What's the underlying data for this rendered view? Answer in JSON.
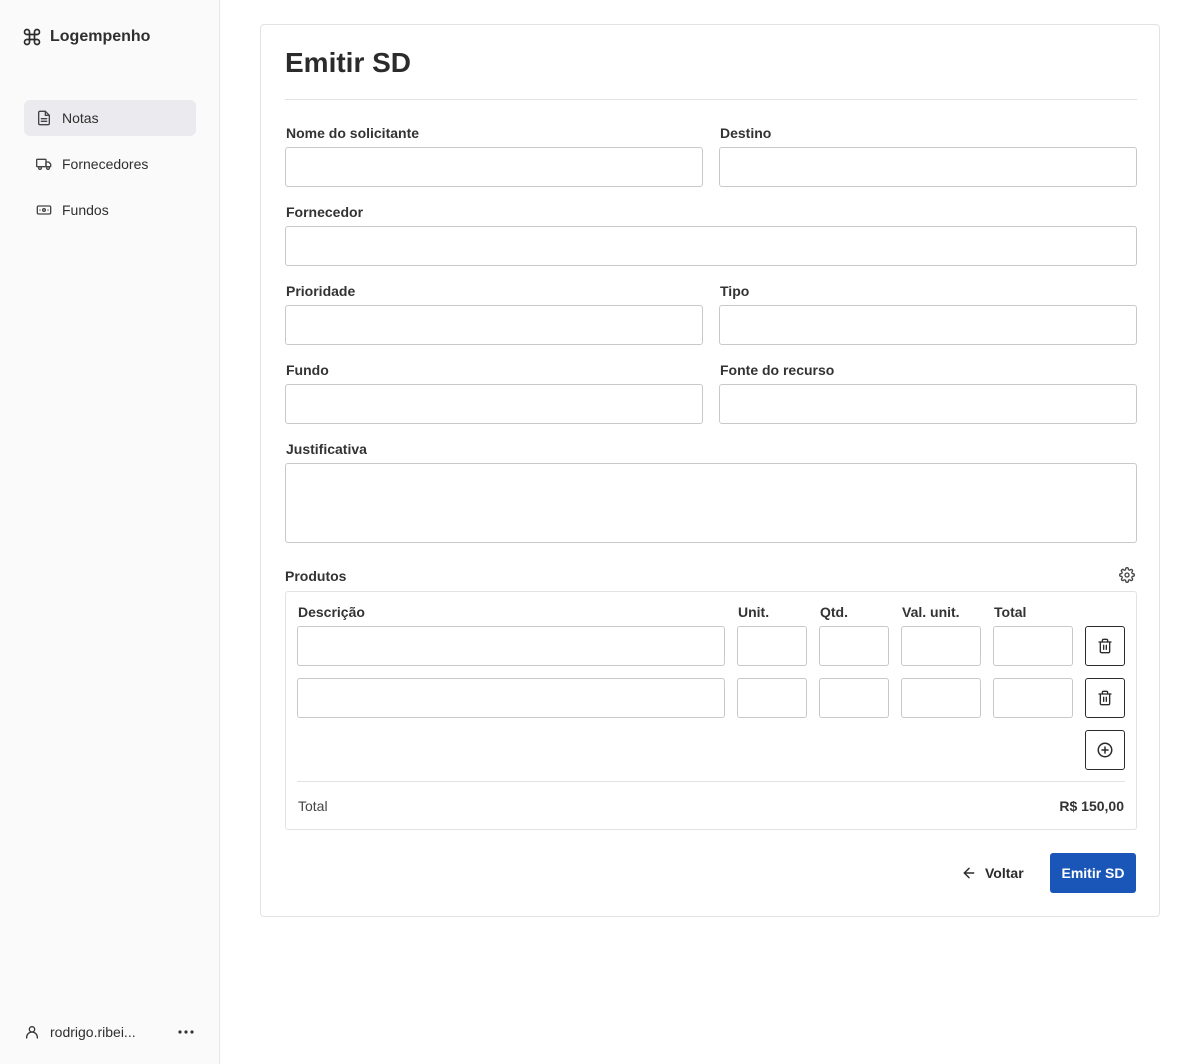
{
  "app": {
    "name": "Logempenho",
    "logo_icon": "command-icon"
  },
  "sidebar": {
    "items": [
      {
        "label": "Notas",
        "icon": "document-icon",
        "active": true
      },
      {
        "label": "Fornecedores",
        "icon": "truck-icon",
        "active": false
      },
      {
        "label": "Fundos",
        "icon": "money-icon",
        "active": false
      }
    ],
    "user": {
      "name": "rodrigo.ribei...",
      "icon": "user-icon",
      "more_icon": "more-icon"
    }
  },
  "form": {
    "title": "Emitir SD",
    "fields": {
      "nome_solicitante": {
        "label": "Nome do solicitante",
        "value": ""
      },
      "destino": {
        "label": "Destino",
        "value": ""
      },
      "fornecedor": {
        "label": "Fornecedor",
        "value": ""
      },
      "prioridade": {
        "label": "Prioridade",
        "value": ""
      },
      "tipo": {
        "label": "Tipo",
        "value": ""
      },
      "fundo": {
        "label": "Fundo",
        "value": ""
      },
      "fonte_recurso": {
        "label": "Fonte do recurso",
        "value": ""
      },
      "justificativa": {
        "label": "Justificativa",
        "value": ""
      }
    },
    "produtos": {
      "label": "Produtos",
      "settings_icon": "gear-icon",
      "columns": [
        "Descrição",
        "Unit.",
        "Qtd.",
        "Val. unit.",
        "Total"
      ],
      "rows": [
        {
          "descricao": "",
          "unit": "",
          "qtd": "",
          "val_unit": "",
          "total": ""
        },
        {
          "descricao": "",
          "unit": "",
          "qtd": "",
          "val_unit": "",
          "total": ""
        }
      ],
      "total_label": "Total",
      "total_value": "R$ 150,00"
    },
    "actions": {
      "back_label": "Voltar",
      "submit_label": "Emitir SD"
    }
  },
  "colors": {
    "primary": "#1a55b8",
    "active_nav": "#ebebef"
  }
}
